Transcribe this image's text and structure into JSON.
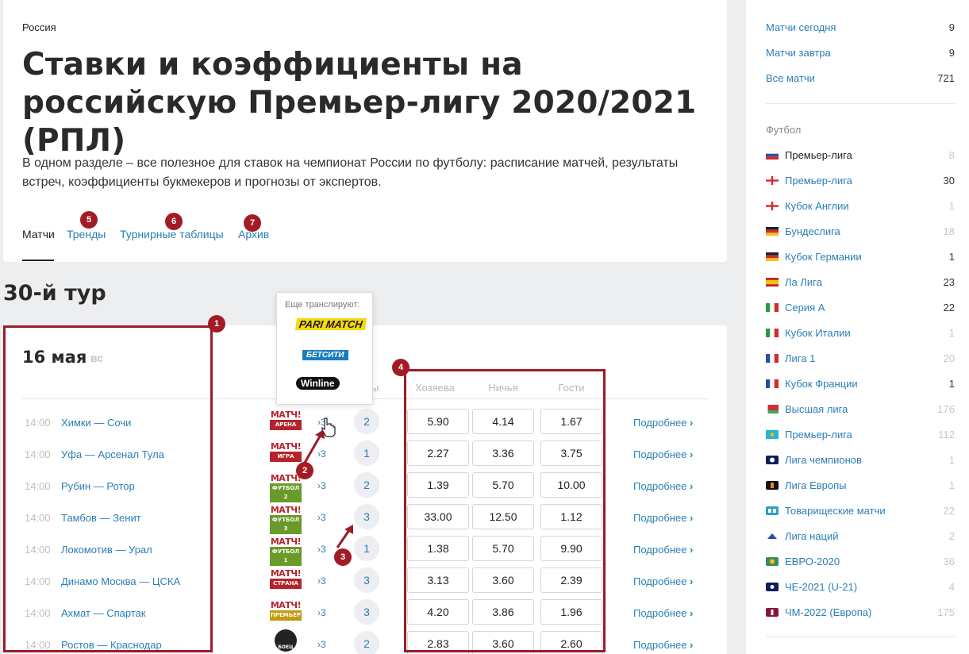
{
  "breadcrumb": "Россия",
  "title": "Ставки и коэффициенты на российскую Премьер-лигу 2020/2021 (РПЛ)",
  "lead": "В одном разделе – все полезное для ставок на чемпионат России по футболу: расписание матчей, результаты встреч, коэффициенты букмекеров и прогнозы от экспертов.",
  "tabs": [
    "Матчи",
    "Тренды",
    "Турнирные таблицы",
    "Архив"
  ],
  "round": "30-й тур",
  "day": {
    "date": "16 мая",
    "weekday": "вс"
  },
  "columns": {
    "forecasts": "озы",
    "home": "Хозяева",
    "draw": "Ничья",
    "away": "Гости"
  },
  "popup": {
    "heading": "Еще транслируют:",
    "bookmakers": [
      "PARI MATCH",
      "БЕТСИТИ",
      "Winline"
    ]
  },
  "detail_label": "Подробнее",
  "matches": [
    {
      "time": "14:00",
      "teams": "Химки — Сочи",
      "tv": [
        "МАТЧ!",
        "АРЕНА"
      ],
      "more": "3",
      "forecasts": "2",
      "home": "5.90",
      "draw": "4.14",
      "away": "1.67"
    },
    {
      "time": "14:00",
      "teams": "Уфа — Арсенал Тула",
      "tv": [
        "МАТЧ!",
        "ИГРА"
      ],
      "more": "3",
      "forecasts": "1",
      "home": "2.27",
      "draw": "3.36",
      "away": "3.75"
    },
    {
      "time": "14:00",
      "teams": "Рубин — Ротор",
      "tv": [
        "МАТЧ!",
        "ФУТБОЛ 2"
      ],
      "more": "3",
      "forecasts": "2",
      "home": "1.39",
      "draw": "5.70",
      "away": "10.00"
    },
    {
      "time": "14:00",
      "teams": "Тамбов — Зенит",
      "tv": [
        "МАТЧ!",
        "ФУТБОЛ 3"
      ],
      "more": "3",
      "forecasts": "3",
      "home": "33.00",
      "draw": "12.50",
      "away": "1.12"
    },
    {
      "time": "14:00",
      "teams": "Локомотив — Урал",
      "tv": [
        "МАТЧ!",
        "ФУТБОЛ 1"
      ],
      "more": "3",
      "forecasts": "1",
      "home": "1.38",
      "draw": "5.70",
      "away": "9.90"
    },
    {
      "time": "14:00",
      "teams": "Динамо Москва — ЦСКА",
      "tv": [
        "МАТЧ!",
        "СТРАНА"
      ],
      "more": "3",
      "forecasts": "3",
      "home": "3.13",
      "draw": "3.60",
      "away": "2.39"
    },
    {
      "time": "14:00",
      "teams": "Ахмат — Спартак",
      "tv": [
        "МАТЧ!",
        "ПРЕМЬЕР"
      ],
      "more": "3",
      "forecasts": "3",
      "home": "4.20",
      "draw": "3.86",
      "away": "1.96"
    },
    {
      "time": "14:00",
      "teams": "Ростов — Краснодар",
      "tv": [
        "",
        "БОЕЦ"
      ],
      "more": "3",
      "forecasts": "2",
      "home": "2.83",
      "draw": "3.60",
      "away": "2.60"
    }
  ],
  "annotations": [
    "1",
    "2",
    "3",
    "4",
    "5",
    "6",
    "7"
  ],
  "sidebar": {
    "top": [
      {
        "label": "Матчи сегодня",
        "count": "9"
      },
      {
        "label": "Матчи завтра",
        "count": "9"
      },
      {
        "label": "Все матчи",
        "count": "721"
      }
    ],
    "section": "Футбол",
    "leagues": [
      {
        "label": "Премьер-лига",
        "count": "8",
        "flag": "ru",
        "active": true
      },
      {
        "label": "Премьер-лига",
        "count": "30",
        "flag": "en"
      },
      {
        "label": "Кубок Англии",
        "count": "1",
        "flag": "en"
      },
      {
        "label": "Бундеслига",
        "count": "18",
        "flag": "de"
      },
      {
        "label": "Кубок Германии",
        "count": "1",
        "flag": "de"
      },
      {
        "label": "Ла Лига",
        "count": "23",
        "flag": "es"
      },
      {
        "label": "Серия А",
        "count": "22",
        "flag": "it"
      },
      {
        "label": "Кубок Италии",
        "count": "1",
        "flag": "it"
      },
      {
        "label": "Лига 1",
        "count": "20",
        "flag": "fr"
      },
      {
        "label": "Кубок Франции",
        "count": "1",
        "flag": "fr"
      },
      {
        "label": "Высшая лига",
        "count": "176",
        "flag": "by"
      },
      {
        "label": "Премьер-лига",
        "count": "112",
        "flag": "kz"
      },
      {
        "label": "Лига чемпионов",
        "count": "1",
        "flag": "ucl"
      },
      {
        "label": "Лига Европы",
        "count": "1",
        "flag": "uel"
      },
      {
        "label": "Товарищеские матчи",
        "count": "22",
        "flag": "fr-match"
      },
      {
        "label": "Лига наций",
        "count": "2",
        "flag": "unl"
      },
      {
        "label": "ЕВРО-2020",
        "count": "36",
        "flag": "euro"
      },
      {
        "label": "ЧЕ-2021 (U-21)",
        "count": "4",
        "flag": "u21"
      },
      {
        "label": "ЧМ-2022 (Европа)",
        "count": "175",
        "flag": "wc"
      }
    ]
  }
}
